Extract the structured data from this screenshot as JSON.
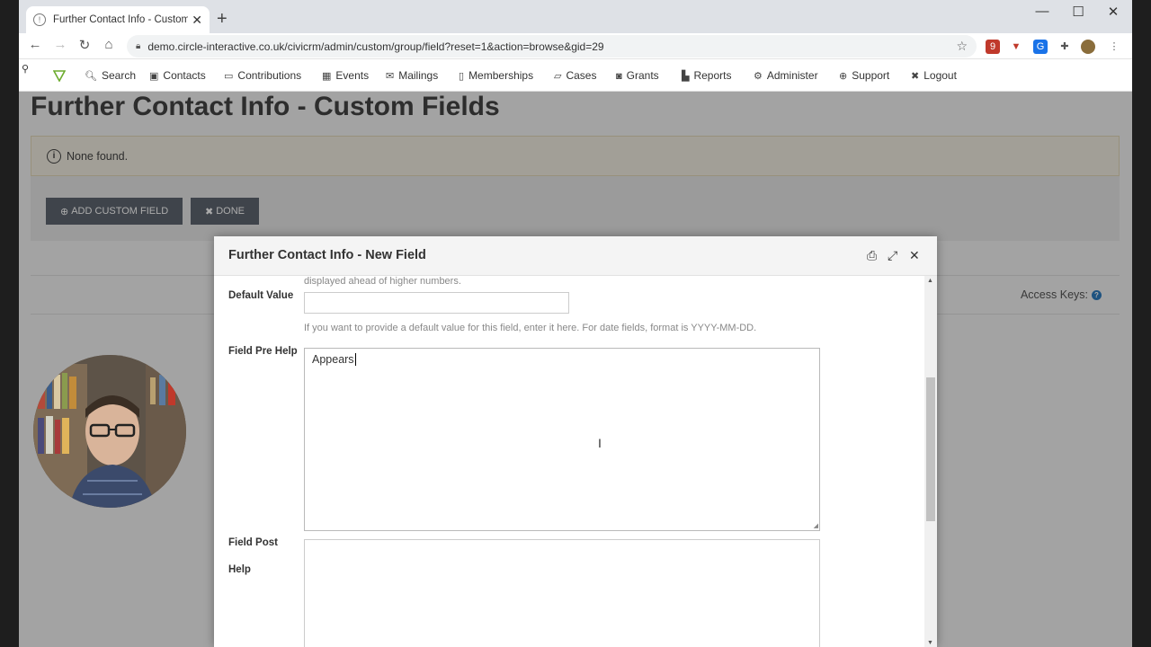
{
  "browser": {
    "tab_title": "Further Contact Info - Custom Fi",
    "tab_favicon": "info-circle-icon",
    "url": "demo.circle-interactive.co.uk/civicrm/admin/custom/group/field?reset=1&action=browse&gid=29",
    "extension_badge": "9"
  },
  "menubar": {
    "items": [
      {
        "label": "Search",
        "icon": "search-icon"
      },
      {
        "label": "Contacts",
        "icon": "contacts-icon"
      },
      {
        "label": "Contributions",
        "icon": "credit-card-icon"
      },
      {
        "label": "Events",
        "icon": "calendar-icon"
      },
      {
        "label": "Mailings",
        "icon": "envelope-icon"
      },
      {
        "label": "Memberships",
        "icon": "id-badge-icon"
      },
      {
        "label": "Cases",
        "icon": "folder-open-icon"
      },
      {
        "label": "Grants",
        "icon": "money-icon"
      },
      {
        "label": "Reports",
        "icon": "bar-chart-icon"
      },
      {
        "label": "Administer",
        "icon": "cogs-icon"
      },
      {
        "label": "Support",
        "icon": "life-ring-icon"
      },
      {
        "label": "Logout",
        "icon": "times-icon"
      }
    ]
  },
  "page": {
    "title": "Further Contact Info - Custom Fields",
    "notice": "None found.",
    "add_button": "ADD CUSTOM FIELD",
    "done_button": "DONE",
    "access_keys": "Access Keys:"
  },
  "dialog": {
    "title": "Further Contact Info - New Field",
    "truncated_help": "displayed ahead of higher numbers.",
    "default_value_label": "Default Value",
    "default_value": "",
    "default_value_help": "If you want to provide a default value for this field, enter it here. For date fields, format is YYYY-MM-DD.",
    "pre_help_label": "Field Pre Help",
    "pre_help_value": "Appears",
    "post_help_label_1": "Field Post",
    "post_help_label_2": "Help",
    "post_help_value": ""
  },
  "colors": {
    "button_bg": "#5f6670",
    "notice_bg": "#f2eee1",
    "access_key_icon": "#2e7cbf"
  }
}
